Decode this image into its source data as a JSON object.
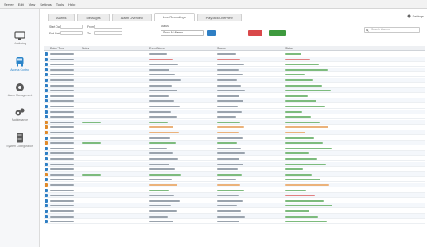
{
  "menubar": [
    "Server",
    "Edit",
    "View",
    "Settings",
    "Tools",
    "Help"
  ],
  "tabs": [
    "Alarms",
    "Messages",
    "Alarm Overview",
    "Live Recordings",
    "Playback Overview"
  ],
  "top_right": "Settings",
  "sidebar": [
    {
      "label": "Monitoring",
      "icon": "monitor-icon"
    },
    {
      "label": "Access Control",
      "icon": "door-icon"
    },
    {
      "label": "Alarm Management",
      "icon": "alarm-icon"
    },
    {
      "label": "Maintenance",
      "icon": "tools-icon"
    },
    {
      "label": "System Configuration",
      "icon": "cabinet-icon"
    }
  ],
  "filters": {
    "start_date_label": "Start Date",
    "end_date_label": "End Date",
    "from_label": "From",
    "to_label": "To",
    "status_label": "Status",
    "status_value": "Show All Alarms",
    "search_placeholder": "Search Alarms"
  },
  "colors": {
    "red_button": "#d9484a",
    "green_button": "#3e9a3e",
    "blue_button": "#2f7fc4"
  },
  "columns": [
    "Date / Time",
    "Notes",
    "Event Name",
    "Source",
    "Status"
  ],
  "rows": [
    {
      "icon": "blue",
      "tone": "n",
      "status_tone": "g"
    },
    {
      "icon": "blue",
      "tone": "r",
      "status_tone": "r"
    },
    {
      "icon": "blue",
      "tone": "n",
      "status_tone": "g"
    },
    {
      "icon": "blue",
      "tone": "n",
      "status_tone": "g"
    },
    {
      "icon": "blue",
      "tone": "n",
      "status_tone": "g"
    },
    {
      "icon": "blue",
      "tone": "n",
      "status_tone": "g"
    },
    {
      "icon": "blue",
      "tone": "n",
      "status_tone": "g"
    },
    {
      "icon": "blue",
      "tone": "n",
      "status_tone": "g"
    },
    {
      "icon": "blue",
      "tone": "n",
      "status_tone": "g"
    },
    {
      "icon": "blue",
      "tone": "n",
      "status_tone": "g"
    },
    {
      "icon": "blue",
      "tone": "n",
      "status_tone": "g"
    },
    {
      "icon": "blue",
      "tone": "n",
      "status_tone": "g"
    },
    {
      "icon": "blue",
      "tone": "n",
      "status_tone": "g"
    },
    {
      "icon": "orange",
      "tone": "g",
      "status_tone": "g"
    },
    {
      "icon": "orange",
      "tone": "o",
      "status_tone": "o"
    },
    {
      "icon": "orange",
      "tone": "o",
      "status_tone": "o"
    },
    {
      "icon": "blue",
      "tone": "n",
      "status_tone": "g"
    },
    {
      "icon": "orange",
      "tone": "g",
      "status_tone": "g"
    },
    {
      "icon": "blue",
      "tone": "n",
      "status_tone": "g"
    },
    {
      "icon": "blue",
      "tone": "n",
      "status_tone": "g"
    },
    {
      "icon": "blue",
      "tone": "n",
      "status_tone": "g"
    },
    {
      "icon": "blue",
      "tone": "n",
      "status_tone": "g"
    },
    {
      "icon": "blue",
      "tone": "n",
      "status_tone": "g"
    },
    {
      "icon": "orange",
      "tone": "g",
      "status_tone": "g"
    },
    {
      "icon": "blue",
      "tone": "n",
      "status_tone": "g"
    },
    {
      "icon": "orange",
      "tone": "o",
      "status_tone": "o"
    },
    {
      "icon": "blue",
      "tone": "g",
      "status_tone": "g"
    },
    {
      "icon": "blue",
      "tone": "n",
      "status_tone": "r"
    },
    {
      "icon": "blue",
      "tone": "n",
      "status_tone": "g"
    },
    {
      "icon": "blue",
      "tone": "n",
      "status_tone": "g"
    },
    {
      "icon": "blue",
      "tone": "n",
      "status_tone": "g"
    },
    {
      "icon": "blue",
      "tone": "n",
      "status_tone": "g"
    },
    {
      "icon": "blue",
      "tone": "n",
      "status_tone": "g"
    }
  ]
}
